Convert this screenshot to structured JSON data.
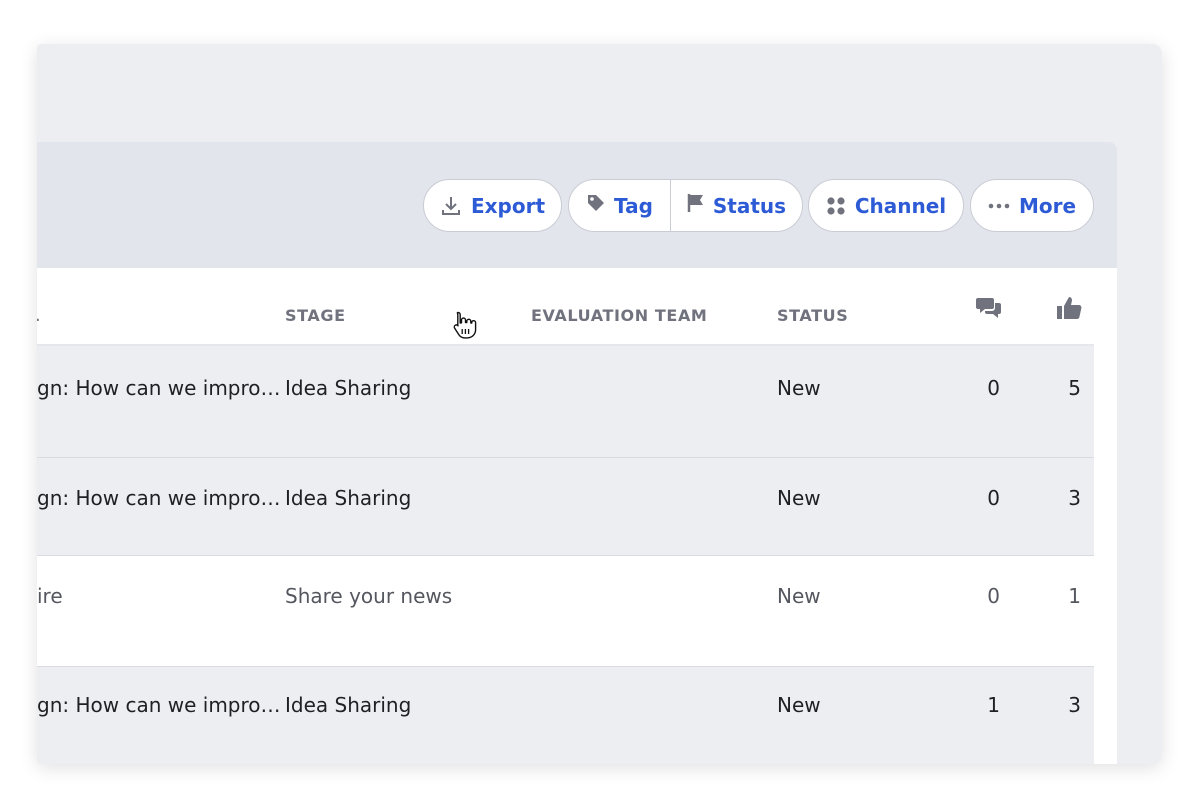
{
  "toolbar": {
    "export_label": "Export",
    "tag_label": "Tag",
    "status_label": "Status",
    "channel_label": "Channel",
    "more_label": "More"
  },
  "table": {
    "headers": {
      "col_partial": "L",
      "stage": "STAGE",
      "evaluation_team": "EVALUATION TEAM",
      "status": "STATUS"
    },
    "rows": [
      {
        "title": "gn: How can we impro…",
        "stage": "Idea Sharing",
        "evaluation_team": "",
        "status": "New",
        "comments": "0",
        "likes": "5"
      },
      {
        "title": "gn: How can we impro…",
        "stage": "Idea Sharing",
        "evaluation_team": "",
        "status": "New",
        "comments": "0",
        "likes": "3"
      },
      {
        "title": "ire",
        "stage": "Share your news",
        "evaluation_team": "",
        "status": "New",
        "comments": "0",
        "likes": "1"
      },
      {
        "title": "gn: How can we impro…",
        "stage": "Idea Sharing",
        "evaluation_team": "",
        "status": "New",
        "comments": "1",
        "likes": "3"
      }
    ]
  },
  "colors": {
    "accent": "#2d5bd6",
    "header_text": "#70737e",
    "row_alt": "#edeef2",
    "toolbar_bg": "#e3e5ed"
  }
}
